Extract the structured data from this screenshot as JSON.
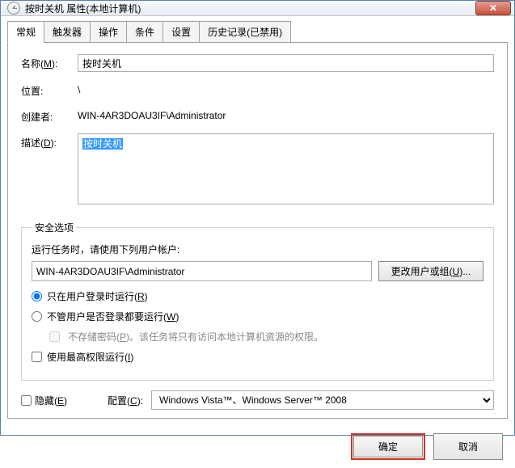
{
  "title": "按时关机 属性(本地计算机)",
  "tabs": [
    "常规",
    "触发器",
    "操作",
    "条件",
    "设置",
    "历史记录(已禁用)"
  ],
  "general": {
    "name_label_pre": "名称(",
    "name_label_u": "M",
    "name_label_post": "):",
    "name_value": "按时关机",
    "location_label": "位置:",
    "location_value": "\\",
    "creator_label": "创建者:",
    "creator_value": "WIN-4AR3DOAU3IF\\Administrator",
    "desc_label_pre": "描述(",
    "desc_label_u": "D",
    "desc_label_post": "):",
    "desc_value": "按时关机"
  },
  "security": {
    "legend": "安全选项",
    "account_hint": "运行任务时，请使用下列用户帐户:",
    "account_value": "WIN-4AR3DOAU3IF\\Administrator",
    "change_user_pre": "更改用户或组(",
    "change_user_u": "U",
    "change_user_post": ")...",
    "radio_logged_pre": "只在用户登录时运行(",
    "radio_logged_u": "R",
    "radio_logged_post": ")",
    "radio_any_pre": "不管用户是否登录都要运行(",
    "radio_any_u": "W",
    "radio_any_post": ")",
    "nopass_pre": "不存储密码(",
    "nopass_u": "P",
    "nopass_post": ")。该任务将只有访问本地计算机资源的权限。",
    "highest_pre": "使用最高权限运行(",
    "highest_u": "I",
    "highest_post": ")"
  },
  "bottom": {
    "hidden_pre": "隐藏(",
    "hidden_u": "E",
    "hidden_post": ")",
    "config_pre": "配置(",
    "config_u": "C",
    "config_post": "):",
    "config_value": "Windows Vista™、Windows Server™ 2008"
  },
  "footer": {
    "ok": "确定",
    "cancel": "取消"
  }
}
